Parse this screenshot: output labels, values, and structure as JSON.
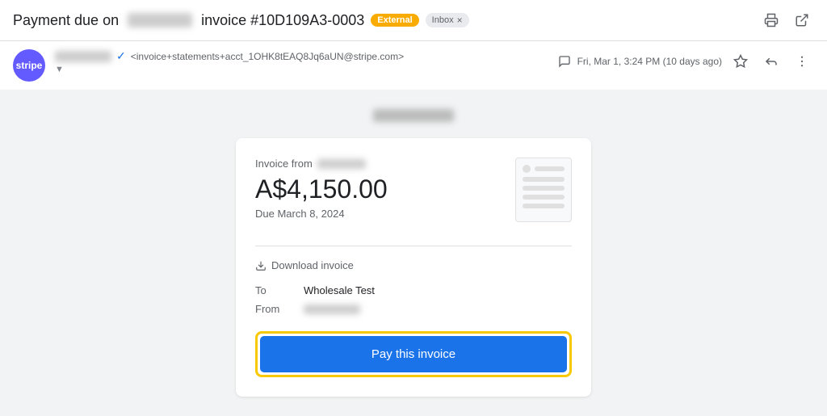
{
  "header": {
    "subject_prefix": "Payment due on",
    "subject_blurred": "[redacted]",
    "subject_suffix": "invoice #10D109A3-0003",
    "badge_external": "External",
    "badge_inbox": "Inbox",
    "print_icon": "🖨",
    "popout_icon": "⬡"
  },
  "sender": {
    "avatar_text": "stripe",
    "name_blurred": "[redacted]",
    "verified": true,
    "email": "<invoice+statements+acct_1OHK8tEAQ8Jq6aUN@stripe.com>",
    "timestamp": "Fri, Mar 1, 3:24 PM (10 days ago)"
  },
  "body": {
    "sender_label_blurred": "[redacted]"
  },
  "invoice": {
    "from_label": "Invoice from",
    "from_blurred": "[redacted]",
    "amount": "A$4,150.00",
    "due_date": "Due March 8, 2024",
    "download_label": "Download invoice",
    "to_label": "To",
    "to_value": "Wholesale Test",
    "from_field_label": "From",
    "from_field_blurred": "[redacted]",
    "pay_button_label": "Pay this invoice"
  }
}
